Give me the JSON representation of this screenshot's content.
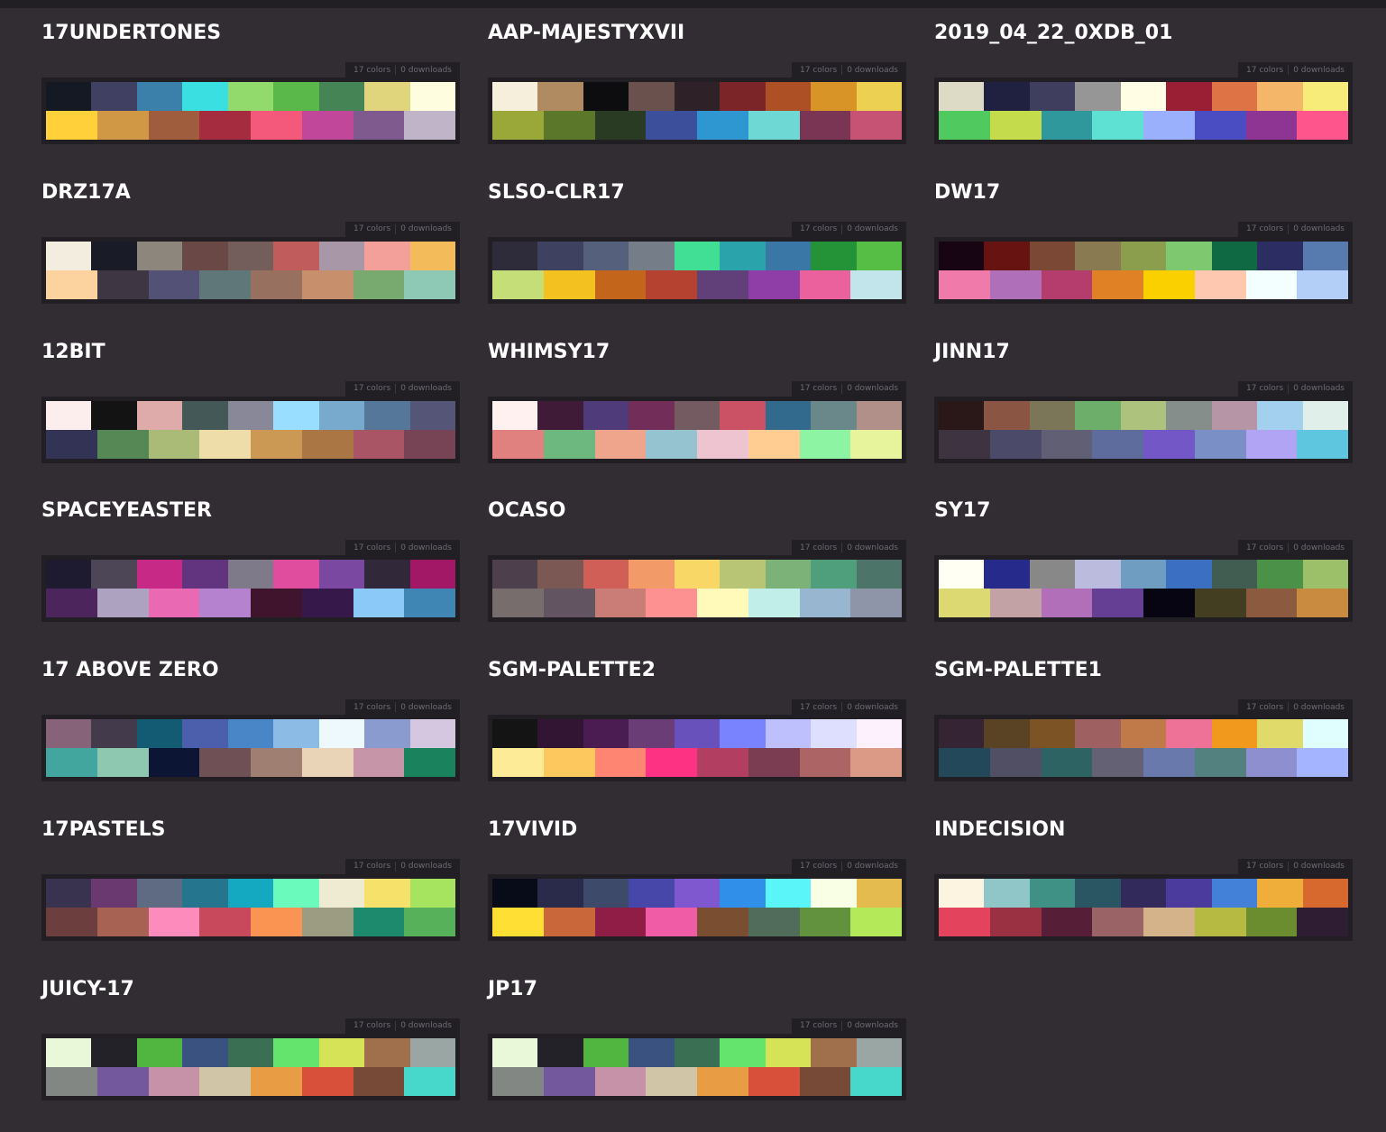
{
  "labels": {
    "colors": "17 colors",
    "downloads": "0 downloads"
  },
  "palettes": [
    {
      "name": "17UNDERTONES",
      "top": [
        "#141924",
        "#3f4062",
        "#3b80aa",
        "#3ae0e1",
        "#92da6c",
        "#5ab84a",
        "#458555",
        "#e0d47c",
        "#fffde0"
      ],
      "bottom": [
        "#ffd03a",
        "#d09845",
        "#a05d3d",
        "#a52b3f",
        "#f4597c",
        "#c0479a",
        "#7e5a8f",
        "#c0b4c8"
      ]
    },
    {
      "name": "AAP-MAJESTYXVII",
      "top": [
        "#f5efdc",
        "#b08a61",
        "#0d0c0f",
        "#6b514d",
        "#2f2128",
        "#7b2528",
        "#ad5025",
        "#d89426",
        "#ecd052"
      ],
      "bottom": [
        "#9aa83a",
        "#5a772a",
        "#2a3b23",
        "#3c4f9a",
        "#2e96d0",
        "#6ed8d4",
        "#7a3555",
        "#c65274"
      ]
    },
    {
      "name": "2019_04_22_0XDB_01",
      "top": [
        "#dddbc5",
        "#202141",
        "#3f3e5e",
        "#969696",
        "#fffee5",
        "#9b1f34",
        "#de7446",
        "#f4b76a",
        "#f7ec79"
      ],
      "bottom": [
        "#50ca5e",
        "#c4db4b",
        "#2f989d",
        "#5ee0d2",
        "#9ab0fc",
        "#4a4cc2",
        "#8e3594",
        "#fe558c"
      ]
    },
    {
      "name": "DRZ17A",
      "top": [
        "#f2edde",
        "#191b27",
        "#8d867c",
        "#6a4845",
        "#735e5b",
        "#c15c5c",
        "#a897a6",
        "#f2a099",
        "#f3bb5a"
      ],
      "bottom": [
        "#fcd29e",
        "#3f3644",
        "#535276",
        "#5f7778",
        "#98705f",
        "#c88f6c",
        "#78a96e",
        "#8ec9b5"
      ]
    },
    {
      "name": "SLSO-CLR17",
      "top": [
        "#2e2c3b",
        "#3e415f",
        "#55607d",
        "#747d88",
        "#41de95",
        "#2aa4aa",
        "#3b77a6",
        "#249337",
        "#56be44"
      ],
      "bottom": [
        "#c6de78",
        "#f3c220",
        "#c4651c",
        "#b54131",
        "#61407a",
        "#8f3da7",
        "#ea619d",
        "#c1e5ea"
      ]
    },
    {
      "name": "DW17",
      "top": [
        "#170514",
        "#661311",
        "#7b4835",
        "#8a7a51",
        "#8a9e4d",
        "#7ec96f",
        "#0f6943",
        "#2b2d63",
        "#577aaf"
      ],
      "bottom": [
        "#f07aaa",
        "#b070b9",
        "#b53d6d",
        "#df8124",
        "#fad000",
        "#fec7b0",
        "#f3ffff",
        "#b3cff7"
      ]
    },
    {
      "name": "12BIT",
      "top": [
        "#fdeeee",
        "#131313",
        "#dfaaaa",
        "#455858",
        "#888899",
        "#99ddff",
        "#77aacc",
        "#557799",
        "#555577"
      ],
      "bottom": [
        "#333355",
        "#558855",
        "#aabb77",
        "#eedda9",
        "#cc9955",
        "#aa7744",
        "#aa5566",
        "#774455"
      ]
    },
    {
      "name": "WHIMSY17",
      "top": [
        "#fff1ef",
        "#3f1b37",
        "#4f3a7a",
        "#722e59",
        "#745b61",
        "#cb5264",
        "#316a8c",
        "#6a8889",
        "#b09088"
      ],
      "bottom": [
        "#e0817f",
        "#6cb87e",
        "#eea58b",
        "#95c4d0",
        "#edc4d0",
        "#ffcd92",
        "#8cf4a2",
        "#e8f49c"
      ]
    },
    {
      "name": "JINN17",
      "top": [
        "#2a1819",
        "#8a5542",
        "#7a7657",
        "#6dae6b",
        "#adc27c",
        "#868e8c",
        "#b696a6",
        "#a4d0f0",
        "#e0efea"
      ],
      "bottom": [
        "#3e3341",
        "#4b4a69",
        "#615f73",
        "#5d6b9d",
        "#7457c6",
        "#7a8fc5",
        "#b2a4f5",
        "#5fc6e0"
      ]
    },
    {
      "name": "SPACEYEASTER",
      "top": [
        "#1e1b31",
        "#4c4657",
        "#c72987",
        "#62347f",
        "#7e7a8a",
        "#e04c9e",
        "#7b48a1",
        "#312939",
        "#a31866"
      ],
      "bottom": [
        "#4d255d",
        "#ada3c1",
        "#e96ab3",
        "#b582cf",
        "#3f142c",
        "#37184b",
        "#8ac9f8",
        "#3f86b5"
      ]
    },
    {
      "name": "OCASO",
      "top": [
        "#4d3f4b",
        "#7c5854",
        "#d05f57",
        "#f39b68",
        "#f8d767",
        "#b8c575",
        "#7cb277",
        "#4f9f7c",
        "#4d7468"
      ],
      "bottom": [
        "#776d6c",
        "#625561",
        "#c97d76",
        "#fd9192",
        "#fff9ba",
        "#c2eeea",
        "#98b6cf",
        "#8e95a9"
      ]
    },
    {
      "name": "SY17",
      "top": [
        "#fffff3",
        "#262a8b",
        "#888888",
        "#babbdd",
        "#6e9dc1",
        "#3b6fc1",
        "#415c50",
        "#4b9147",
        "#9cc069"
      ],
      "bottom": [
        "#dcd872",
        "#c2a2a4",
        "#b06fb8",
        "#643f93",
        "#070511",
        "#433e22",
        "#8c5b3f",
        "#c98b40"
      ]
    },
    {
      "name": "17 ABOVE ZERO",
      "top": [
        "#87637a",
        "#433a4c",
        "#135a73",
        "#4b5fad",
        "#4886c8",
        "#8cbce6",
        "#edf9fd",
        "#8a9ccf",
        "#d5c7e0"
      ],
      "bottom": [
        "#42a69e",
        "#8ec8b0",
        "#0c1534",
        "#6e5055",
        "#9e7f72",
        "#ead4b7",
        "#c696a8",
        "#1a835e"
      ]
    },
    {
      "name": "SGM-PALETTE2",
      "top": [
        "#141414",
        "#321433",
        "#4a1c52",
        "#6a3d76",
        "#6951bc",
        "#7983fe",
        "#bec0fd",
        "#dedefe",
        "#fef1fe"
      ],
      "bottom": [
        "#fdeb98",
        "#fdc95f",
        "#fd8571",
        "#fd3283",
        "#b23f62",
        "#7b3d51",
        "#ac6465",
        "#da9a85"
      ]
    },
    {
      "name": "SGM-PALETTE1",
      "top": [
        "#342434",
        "#5a4224",
        "#7b5324",
        "#9e6060",
        "#c07a4a",
        "#ee7297",
        "#f0991d",
        "#e0da6b",
        "#e0fefe"
      ],
      "bottom": [
        "#22485a",
        "#514f64",
        "#2e6364",
        "#646174",
        "#6979ab",
        "#528180",
        "#8d8fce",
        "#a4b4fe"
      ]
    },
    {
      "name": "17PASTELS",
      "top": [
        "#3a3350",
        "#6a396f",
        "#5e6b83",
        "#26758f",
        "#14a9c0",
        "#69fabc",
        "#efebd2",
        "#f6e26a",
        "#a6e35e"
      ],
      "bottom": [
        "#6c3e3e",
        "#a76253",
        "#fd8bbb",
        "#c8495c",
        "#fa9452",
        "#9b9c81",
        "#1e8a6d",
        "#57b15a"
      ]
    },
    {
      "name": "17VIVID",
      "top": [
        "#080b18",
        "#2a2a4b",
        "#3d4a6a",
        "#4747a9",
        "#7f57cf",
        "#3090e9",
        "#59f5f9",
        "#f8ffe5",
        "#e3bb4e"
      ],
      "bottom": [
        "#ffdf34",
        "#c9673b",
        "#8f1d45",
        "#f05ca6",
        "#7a4f31",
        "#526c5b",
        "#63923f",
        "#b4ea5a"
      ]
    },
    {
      "name": "INDECISION",
      "top": [
        "#fcf3e0",
        "#91c6c8",
        "#3f9186",
        "#2a5562",
        "#312a5b",
        "#4a3b9c",
        "#4380d8",
        "#efad39",
        "#d7692f"
      ],
      "bottom": [
        "#e3435d",
        "#993142",
        "#561e37",
        "#9a6365",
        "#d4b38b",
        "#b6b942",
        "#6c8c30",
        "#2f1d33"
      ]
    },
    {
      "name": "JUICY-17",
      "top": [
        "#e8f8d8",
        "#242229",
        "#51b640",
        "#395280",
        "#3b6f53",
        "#65e46d",
        "#d6e356",
        "#a06f4c",
        "#9aa6a4"
      ],
      "bottom": [
        "#838784",
        "#73589e",
        "#c692a8",
        "#d0c6a7",
        "#e89c44",
        "#d9503a",
        "#764a37",
        "#47d7cb"
      ]
    },
    {
      "name": "JP17",
      "top": [
        "#e8f8d8",
        "#242229",
        "#51b640",
        "#395280",
        "#3b6f53",
        "#65e46d",
        "#d6e356",
        "#a06f4c",
        "#9aa6a4"
      ],
      "bottom": [
        "#838784",
        "#73589e",
        "#c692a8",
        "#d0c6a7",
        "#e89c44",
        "#d9503a",
        "#764a37",
        "#47d7cb"
      ]
    }
  ]
}
